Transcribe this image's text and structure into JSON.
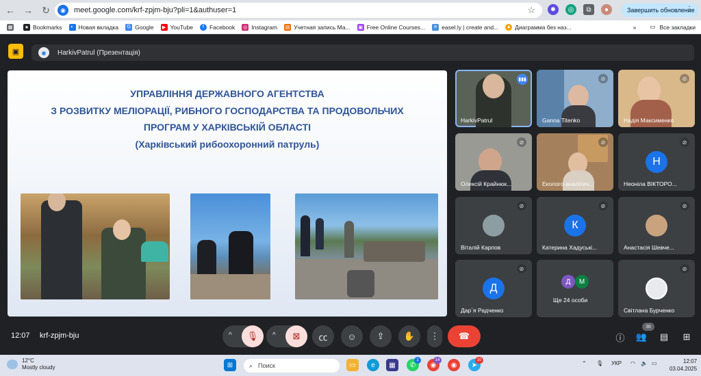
{
  "browser": {
    "url": "meet.google.com/krf-zpjm-bju?pli=1&authuser=1",
    "update_button": "Завершить обновление"
  },
  "bookmarks": {
    "items": [
      "Bookmarks",
      "Новая вкладка",
      "Google",
      "YouTube",
      "Facebook",
      "Instagram",
      "Учетная запись Ма...",
      "Free Online Courses...",
      "easel.ly | create and...",
      "Диаграмма без наз..."
    ],
    "more": "»",
    "all_bookmarks": "Все закладки"
  },
  "meet": {
    "presenter_title": "HarkivPatrul (Презентація)",
    "slide": {
      "title_lines": [
        "УПРАВЛІННЯ ДЕРЖАВНОГО АГЕНТСТВА",
        "З РОЗВИТКУ МЕЛІОРАЦІЇ, РИБНОГО ГОСПОДАРСТВА ТА ПРОДОВОЛЬЧИХ",
        "ПРОГРАМ У ХАРКІВСЬКІЙ ОБЛАСТІ",
        "(Харківський рибоохоронний патруль)"
      ]
    },
    "participants": [
      {
        "name": "HarkivPatrul",
        "avatar": "",
        "color": "#4a5a4a",
        "video": true,
        "speaking": true
      },
      {
        "name": "Ganna Titenko",
        "avatar": "",
        "color": "#6c8fb0",
        "video": true,
        "speaking": false
      },
      {
        "name": "Надія Максименко",
        "avatar": "",
        "color": "#d9a86c",
        "video": true,
        "speaking": false
      },
      {
        "name": "Олексій Крайнюк...",
        "avatar": "",
        "color": "#8a8f96",
        "video": true,
        "speaking": false
      },
      {
        "name": "Еколого-аналітич...",
        "avatar": "",
        "color": "#9c7a55",
        "video": true,
        "speaking": false
      },
      {
        "name": "Неоніла ВІКТОРО...",
        "avatar": "Н",
        "color": "#1a73e8",
        "video": false,
        "speaking": false
      },
      {
        "name": "Віталій Карпов",
        "avatar": "",
        "color": "#8d9ea3",
        "video": false,
        "speaking": false
      },
      {
        "name": "Катерина Хадуські...",
        "avatar": "К",
        "color": "#1a73e8",
        "video": false,
        "speaking": false
      },
      {
        "name": "Анастасія Шевче...",
        "avatar": "",
        "color": "#c9a27e",
        "video": false,
        "speaking": false
      },
      {
        "name": "Дар`я Радченко",
        "avatar": "Д",
        "color": "#1a73e8",
        "video": false,
        "speaking": false
      },
      {
        "name": "Ще 24 особи",
        "avatar": "ДМ",
        "color": "#7e57c2",
        "video": false,
        "speaking": false
      },
      {
        "name": "Світлана Бурченко",
        "avatar": "",
        "color": "#e0e0e0",
        "video": false,
        "speaking": false
      }
    ],
    "clock": "12:07",
    "meeting_code": "krf-zpjm-bju",
    "people_count": "36"
  },
  "taskbar": {
    "temperature": "12°C",
    "weather": "Mostly cloudy",
    "search_placeholder": "Поиск",
    "language": "УКР",
    "time": "12:07",
    "date": "03.04.2025",
    "badge_1": "1",
    "badge_2": "14",
    "badge_3": "10"
  }
}
